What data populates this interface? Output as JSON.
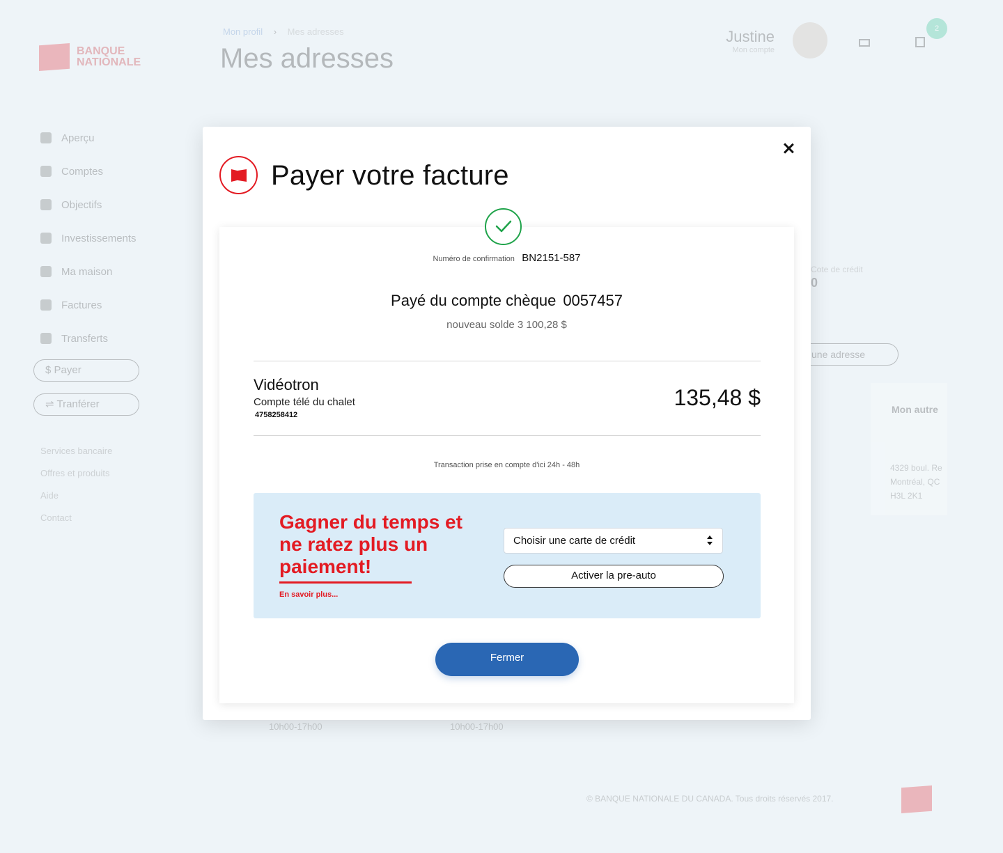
{
  "background": {
    "logo_text": "BANQUE NATIONALE",
    "breadcrumb": {
      "parent": "Mon profil",
      "current": "Mes adresses"
    },
    "page_title": "Mes adresses",
    "user": {
      "name": "Justine",
      "subtitle": "Mon compte"
    },
    "cart_count": "2",
    "sidebar": {
      "items": [
        {
          "label": "Aperçu",
          "icon": "grid-icon"
        },
        {
          "label": "Comptes",
          "icon": "wallet-icon"
        },
        {
          "label": "Objectifs",
          "icon": "layers-icon"
        },
        {
          "label": "Investissements",
          "icon": "bar-chart-icon"
        },
        {
          "label": "Ma maison",
          "icon": "pie-icon"
        },
        {
          "label": "Factures",
          "icon": "document-icon"
        },
        {
          "label": "Transferts",
          "icon": "users-icon"
        }
      ],
      "pay_button": "$ Payer",
      "transfer_button": "⇌ Tranférer",
      "links": [
        "Services bancaire",
        "Offres et produits",
        "Aide",
        "Contact"
      ]
    },
    "credit_label": "Cote de crédit",
    "credit_value": "0",
    "add_address_button": "une adresse",
    "panel_title": "Mon autre",
    "panel_address": [
      "4329 boul. Re",
      "Montréal, QC",
      "H3L 2K1"
    ],
    "hours_1": "10h00-17h00",
    "hours_2": "10h00-17h00",
    "footer": "© BANQUE NATIONALE DU CANADA. Tous droits réservés 2017."
  },
  "modal": {
    "title": "Payer votre facture",
    "confirmation_label": "Numéro de confirmation",
    "confirmation_number": "BN2151-587",
    "paid_from": "Payé du compte chèque",
    "account_number": "0057457",
    "new_balance": "nouveau solde 3 100,28 $",
    "payee": {
      "name": "Vidéotron",
      "description": "Compte télé du chalet",
      "number": "4758258412"
    },
    "amount": "135,48 $",
    "notice": "Transaction prise en compte d'ici 24h - 48h",
    "promo": {
      "title": "Gagner du temps et ne ratez plus un paiement!",
      "link": "En savoir plus...",
      "select_value": "Choisir une carte de crédit",
      "activate_button": "Activer la pre-auto"
    },
    "close_button": "Fermer"
  },
  "colors": {
    "brand_red": "#e31b23",
    "primary_blue": "#2a67b4",
    "success_green": "#1fa34a",
    "promo_bg": "#daecf8"
  }
}
